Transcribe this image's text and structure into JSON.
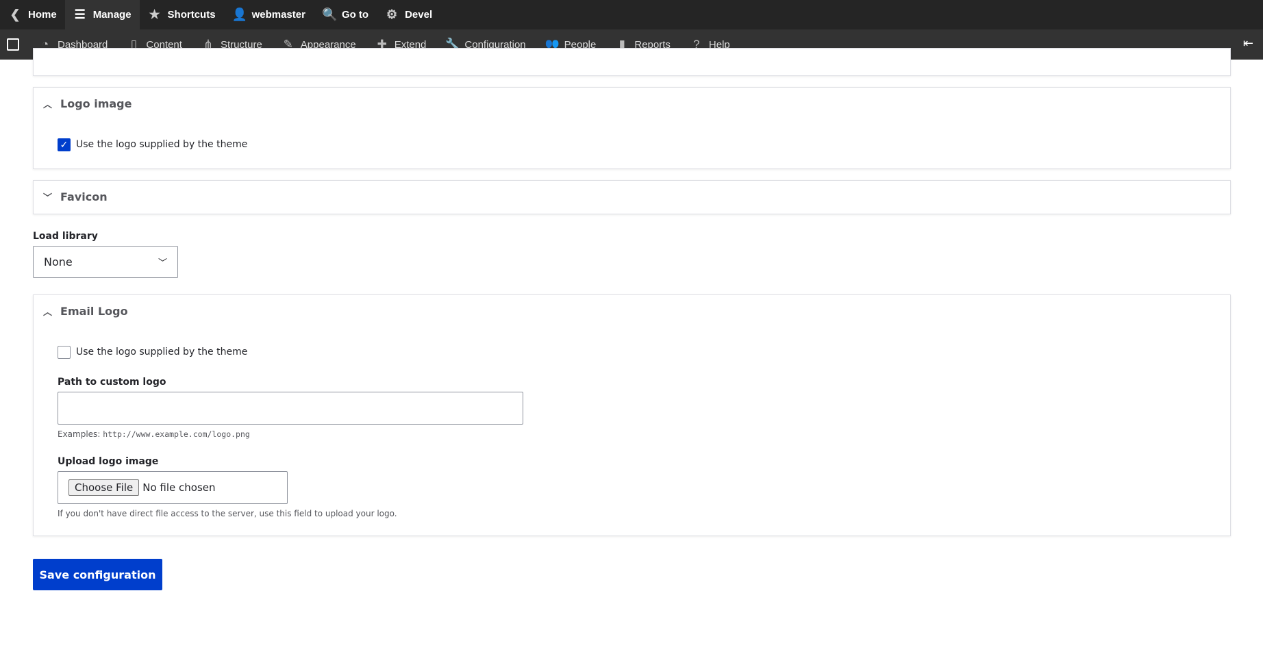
{
  "toolbar": {
    "items": [
      {
        "label": "Home",
        "icon": "back-circle-icon"
      },
      {
        "label": "Manage",
        "icon": "menu-icon"
      },
      {
        "label": "Shortcuts",
        "icon": "star-icon"
      },
      {
        "label": "webmaster",
        "icon": "user-icon"
      },
      {
        "label": "Go to",
        "icon": "search-icon"
      },
      {
        "label": "Devel",
        "icon": "gear-icon"
      }
    ]
  },
  "admin_menu": {
    "items": [
      {
        "label": "Dashboard"
      },
      {
        "label": "Content"
      },
      {
        "label": "Structure"
      },
      {
        "label": "Appearance"
      },
      {
        "label": "Extend"
      },
      {
        "label": "Configuration"
      },
      {
        "label": "People"
      },
      {
        "label": "Reports"
      },
      {
        "label": "Help"
      }
    ]
  },
  "logo_image": {
    "title": "Logo image",
    "checkbox_label": "Use the logo supplied by the theme",
    "checked": true
  },
  "favicon": {
    "title": "Favicon"
  },
  "load_library": {
    "label": "Load library",
    "value": "None"
  },
  "email_logo": {
    "title": "Email Logo",
    "checkbox_label": "Use the logo supplied by the theme",
    "checked": false,
    "path_label": "Path to custom logo",
    "path_value": "",
    "examples_prefix": "Examples:",
    "examples_code": "http://www.example.com/logo.png",
    "upload_label": "Upload logo image",
    "choose_file": "Choose File",
    "no_file": "No file chosen",
    "upload_help": "If you don't have direct file access to the server, use this field to upload your logo."
  },
  "save_label": "Save configuration",
  "colors": {
    "accent": "#003ecc",
    "toolbar": "#252525",
    "subbar": "#333333"
  }
}
